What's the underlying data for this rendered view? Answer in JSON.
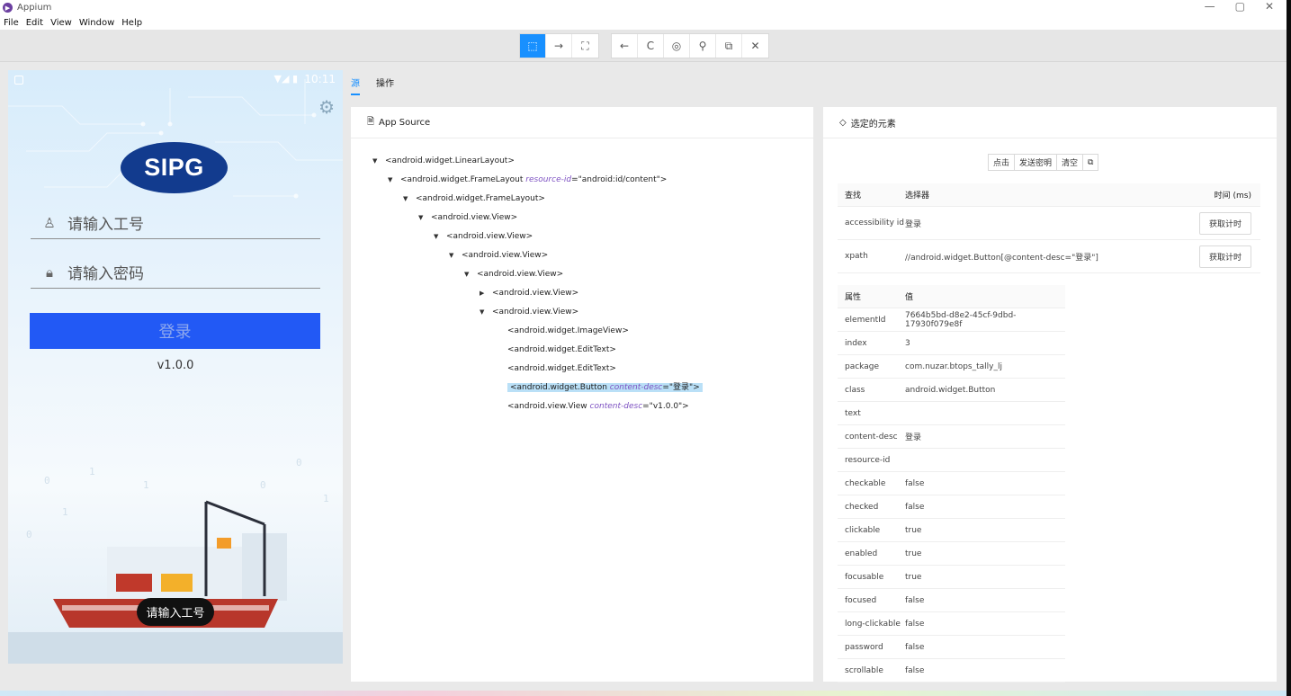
{
  "window": {
    "title": "Appium",
    "controls": [
      "—",
      "▢",
      "✕"
    ]
  },
  "menu": [
    "File",
    "Edit",
    "View",
    "Window",
    "Help"
  ],
  "toolbar": {
    "group1": [
      {
        "name": "select-elements-icon",
        "glyph": "⬚",
        "active": true
      },
      {
        "name": "swipe-icon",
        "glyph": "→",
        "active": false
      },
      {
        "name": "tap-coordinates-icon",
        "glyph": "⛶",
        "active": false
      }
    ],
    "group2": [
      {
        "name": "back-icon",
        "glyph": "←"
      },
      {
        "name": "refresh-icon",
        "glyph": "C"
      },
      {
        "name": "eye-icon",
        "glyph": "◎"
      },
      {
        "name": "search-icon",
        "glyph": "⚲"
      },
      {
        "name": "copy-icon",
        "glyph": "⧉"
      },
      {
        "name": "close-icon",
        "glyph": "✕"
      }
    ]
  },
  "phone": {
    "time": "10:11",
    "signal": "▼◢ ▮",
    "logo": "SIPG",
    "username_placeholder": "请输入工号",
    "password_placeholder": "请输入密码",
    "login_label": "登录",
    "version": "v1.0.0",
    "toast": "请输入工号"
  },
  "tabs": [
    {
      "label": "源",
      "active": true
    },
    {
      "label": "操作",
      "active": false
    }
  ],
  "source": {
    "title": "App Source",
    "nodes": [
      {
        "indent": 0,
        "toggle": "▼",
        "tag": "<android.widget.LinearLayout>",
        "attr": "",
        "value": "",
        "selected": false
      },
      {
        "indent": 1,
        "toggle": "▼",
        "tag": "<android.widget.FrameLayout ",
        "attr": "resource-id",
        "value": "=\"android:id/content\">",
        "selected": false
      },
      {
        "indent": 2,
        "toggle": "▼",
        "tag": "<android.widget.FrameLayout>",
        "attr": "",
        "value": "",
        "selected": false
      },
      {
        "indent": 3,
        "toggle": "▼",
        "tag": "<android.view.View>",
        "attr": "",
        "value": "",
        "selected": false
      },
      {
        "indent": 4,
        "toggle": "▼",
        "tag": "<android.view.View>",
        "attr": "",
        "value": "",
        "selected": false
      },
      {
        "indent": 5,
        "toggle": "▼",
        "tag": "<android.view.View>",
        "attr": "",
        "value": "",
        "selected": false
      },
      {
        "indent": 6,
        "toggle": "▼",
        "tag": "<android.view.View>",
        "attr": "",
        "value": "",
        "selected": false
      },
      {
        "indent": 7,
        "toggle": "▶",
        "tag": "<android.view.View>",
        "attr": "",
        "value": "",
        "selected": false
      },
      {
        "indent": 7,
        "toggle": "▼",
        "tag": "<android.view.View>",
        "attr": "",
        "value": "",
        "selected": false
      },
      {
        "indent": 8,
        "toggle": "",
        "tag": "<android.widget.ImageView>",
        "attr": "",
        "value": "",
        "selected": false
      },
      {
        "indent": 8,
        "toggle": "",
        "tag": "<android.widget.EditText>",
        "attr": "",
        "value": "",
        "selected": false
      },
      {
        "indent": 8,
        "toggle": "",
        "tag": "<android.widget.EditText>",
        "attr": "",
        "value": "",
        "selected": false
      },
      {
        "indent": 8,
        "toggle": "",
        "tag": "<android.widget.Button ",
        "attr": "content-desc",
        "value": "=\"登录\">",
        "selected": true
      },
      {
        "indent": 8,
        "toggle": "",
        "tag": "<android.view.View ",
        "attr": "content-desc",
        "value": "=\"v1.0.0\">",
        "selected": false
      }
    ]
  },
  "selected": {
    "title": "选定的元素",
    "actions": [
      "点击",
      "发送密明",
      "清空",
      "⧉"
    ],
    "find_headers": {
      "find": "查找",
      "selector": "选择器",
      "time": "时间 (ms)"
    },
    "find_rows": [
      {
        "strategy": "accessibility id",
        "selector": "登录",
        "button": "获取计时"
      },
      {
        "strategy": "xpath",
        "selector": "//android.widget.Button[@content-desc=\"登录\"]",
        "button": "获取计时"
      }
    ],
    "attr_headers": {
      "attr": "属性",
      "value": "值"
    },
    "attributes": [
      {
        "k": "elementId",
        "v": "7664b5bd-d8e2-45cf-9dbd-17930f079e8f"
      },
      {
        "k": "index",
        "v": "3"
      },
      {
        "k": "package",
        "v": "com.nuzar.btops_tally_lj"
      },
      {
        "k": "class",
        "v": "android.widget.Button"
      },
      {
        "k": "text",
        "v": ""
      },
      {
        "k": "content-desc",
        "v": "登录"
      },
      {
        "k": "resource-id",
        "v": ""
      },
      {
        "k": "checkable",
        "v": "false"
      },
      {
        "k": "checked",
        "v": "false"
      },
      {
        "k": "clickable",
        "v": "true"
      },
      {
        "k": "enabled",
        "v": "true"
      },
      {
        "k": "focusable",
        "v": "true"
      },
      {
        "k": "focused",
        "v": "false"
      },
      {
        "k": "long-clickable",
        "v": "false"
      },
      {
        "k": "password",
        "v": "false"
      },
      {
        "k": "scrollable",
        "v": "false"
      }
    ]
  },
  "colors": {
    "accent": "#1890ff",
    "login_button": "#2259f5",
    "logo": "#123b8e",
    "selection": "#bae0f7"
  }
}
